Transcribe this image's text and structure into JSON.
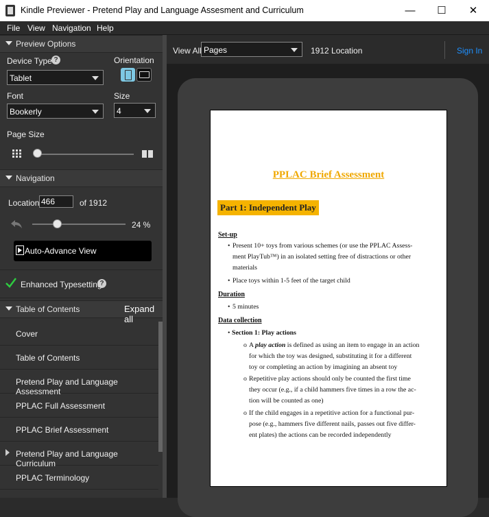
{
  "window": {
    "title": "Kindle Previewer - Pretend Play and Language Assesment and Curriculum",
    "minimize": "—",
    "maximize": "☐",
    "close": "✕"
  },
  "menu": [
    "File",
    "View",
    "Navigation",
    "Help"
  ],
  "preview_options": {
    "header": "Preview Options",
    "device_type_label": "Device Type",
    "device_type_value": "Tablet",
    "orientation_label": "Orientation",
    "font_label": "Font",
    "font_value": "Bookerly",
    "size_label": "Size",
    "size_value": "4",
    "page_size_label": "Page Size"
  },
  "navigation": {
    "header": "Navigation",
    "location_label": "Location",
    "location_value": "466",
    "location_of": "of 1912",
    "progress_text": "24 %",
    "progress_fraction": 0.24,
    "auto_advance": "Auto-Advance View",
    "enhanced": "Enhanced Typesetting"
  },
  "toc": {
    "header": "Table of Contents",
    "expand_all": "Expand all",
    "items": [
      "Cover",
      "Table of Contents",
      "Pretend Play and Language Assessment",
      "PPLAC Full Assessment",
      "PPLAC Brief Assessment",
      "Pretend Play and Language Curriculum",
      "PPLAC Terminology"
    ]
  },
  "toolbar": {
    "view_all": "View All",
    "pages_select": "Pages",
    "location_count": "1912 Location",
    "sign_in": "Sign In"
  },
  "page": {
    "title": "PPLAC Brief Assessment",
    "part": "Part 1: Independent Play",
    "setup": "Set-up",
    "setup_b1_l1": "Present 10+ toys from various schemes (or use the PPLAC Assess-",
    "setup_b1_l2": "ment PlayTub™) in an isolated setting free of distractions or other",
    "setup_b1_l3": "materials",
    "setup_b2": "Place toys within 1-5 feet of the target child",
    "duration": "Duration",
    "duration_b1": "5 minutes",
    "data_collection": "Data collection",
    "section1": "Section 1: Play actions",
    "o1_l1_a": "A ",
    "o1_l1_em": "play action",
    "o1_l1_b": " is defined as using an item to engage in an action",
    "o1_l2": "for which the toy was designed, substituting it for a different",
    "o1_l3": "toy or completing an action by imagining an absent toy",
    "o2_l1": "Repetitive play actions should only be counted the first time",
    "o2_l2": "they occur (e.g., if a child hammers five times in a row the ac-",
    "o2_l3": "tion will be counted as one)",
    "o3_l1": "If the child engages in a repetitive action for a functional pur-",
    "o3_l2": "pose (e.g., hammers five different nails, passes out five differ-",
    "o3_l3": "ent plates) the actions can be recorded independently",
    "bullet": "•",
    "sub_bullet": "o"
  },
  "colors": {
    "accent": "#f5b300",
    "link": "#1e90ff",
    "check": "#2ecc40"
  }
}
